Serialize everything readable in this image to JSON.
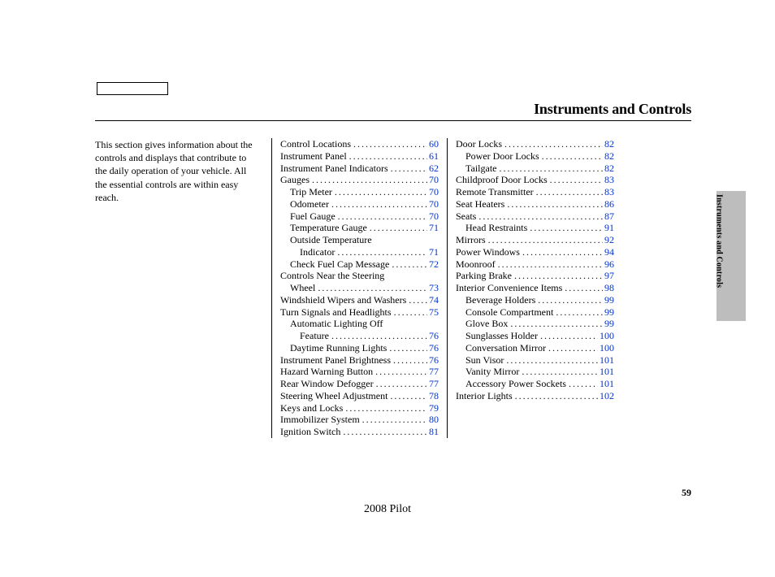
{
  "section_title": "Instruments and Controls",
  "intro_text": "This section gives information about the controls and displays that contribute to the daily operation of your vehicle. All the essential controls are within easy reach.",
  "side_tab_label": "Instruments and Controls",
  "page_number": "59",
  "footer_model": "2008  Pilot",
  "columns": [
    {
      "entries": [
        {
          "label": "Control Locations",
          "page": "60",
          "indent": 0
        },
        {
          "label": "Instrument Panel",
          "page": "61",
          "indent": 0
        },
        {
          "label": "Instrument Panel Indicators",
          "page": "62",
          "indent": 0
        },
        {
          "label": "Gauges",
          "page": "70",
          "indent": 0
        },
        {
          "label": "Trip Meter",
          "page": "70",
          "indent": 1
        },
        {
          "label": "Odometer",
          "page": "70",
          "indent": 1
        },
        {
          "label": "Fuel Gauge",
          "page": "70",
          "indent": 1
        },
        {
          "label": "Temperature Gauge",
          "page": "71",
          "indent": 1
        },
        {
          "label": "Outside Temperature",
          "no_page": true,
          "indent": 1
        },
        {
          "label": "Indicator",
          "page": "71",
          "indent": 2
        },
        {
          "label": "Check Fuel Cap Message",
          "page": "72",
          "indent": 1
        },
        {
          "label": "Controls Near the Steering",
          "no_page": true,
          "indent": 0
        },
        {
          "label": "Wheel",
          "page": "73",
          "indent": 1
        },
        {
          "label": "Windshield Wipers and Washers",
          "page": "74",
          "indent": 0
        },
        {
          "label": "Turn Signals and Headlights",
          "page": "75",
          "indent": 0
        },
        {
          "label": "Automatic Lighting Off",
          "no_page": true,
          "indent": 1
        },
        {
          "label": "Feature",
          "page": "76",
          "indent": 2
        },
        {
          "label": "Daytime Running Lights",
          "page": "76",
          "indent": 1
        },
        {
          "label": "Instrument Panel Brightness",
          "page": "76",
          "indent": 0
        },
        {
          "label": "Hazard Warning Button",
          "page": "77",
          "indent": 0
        },
        {
          "label": "Rear Window Defogger",
          "page": "77",
          "indent": 0
        },
        {
          "label": "Steering Wheel Adjustment",
          "page": "78",
          "indent": 0
        },
        {
          "label": "Keys and Locks",
          "page": "79",
          "indent": 0
        },
        {
          "label": "Immobilizer System",
          "page": "80",
          "indent": 0
        },
        {
          "label": "Ignition Switch",
          "page": "81",
          "indent": 0
        }
      ]
    },
    {
      "entries": [
        {
          "label": "Door Locks",
          "page": "82",
          "indent": 0
        },
        {
          "label": "Power Door Locks",
          "page": "82",
          "indent": 1
        },
        {
          "label": "Tailgate",
          "page": "82",
          "indent": 1
        },
        {
          "label": "Childproof Door Locks",
          "page": "83",
          "indent": 0
        },
        {
          "label": "Remote Transmitter",
          "page": "83",
          "indent": 0
        },
        {
          "label": "Seat Heaters",
          "page": "86",
          "indent": 0
        },
        {
          "label": "Seats",
          "page": "87",
          "indent": 0
        },
        {
          "label": "Head Restraints",
          "page": "91",
          "indent": 1
        },
        {
          "label": "Mirrors",
          "page": "92",
          "indent": 0
        },
        {
          "label": "Power Windows",
          "page": "94",
          "indent": 0
        },
        {
          "label": "Moonroof",
          "page": "96",
          "indent": 0
        },
        {
          "label": "Parking Brake",
          "page": "97",
          "indent": 0
        },
        {
          "label": "Interior Convenience Items",
          "page": "98",
          "indent": 0
        },
        {
          "label": "Beverage Holders",
          "page": "99",
          "indent": 1
        },
        {
          "label": "Console Compartment",
          "page": "99",
          "indent": 1
        },
        {
          "label": "Glove Box",
          "page": "99",
          "indent": 1
        },
        {
          "label": "Sunglasses Holder",
          "page": "100",
          "indent": 1
        },
        {
          "label": "Conversation Mirror",
          "page": "100",
          "indent": 1
        },
        {
          "label": "Sun Visor",
          "page": "101",
          "indent": 1
        },
        {
          "label": "Vanity Mirror",
          "page": "101",
          "indent": 1
        },
        {
          "label": "Accessory Power Sockets",
          "page": "101",
          "indent": 1
        },
        {
          "label": "Interior Lights",
          "page": "102",
          "indent": 0
        }
      ]
    }
  ]
}
